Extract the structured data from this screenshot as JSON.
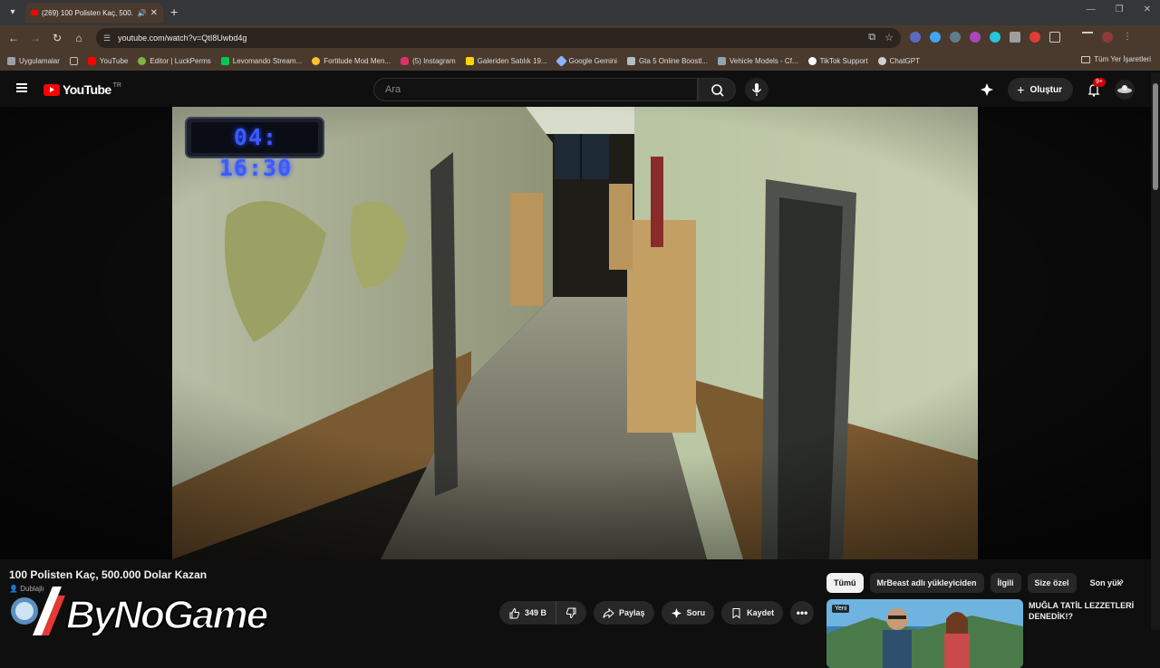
{
  "browser": {
    "tab_title": "(269) 100 Polisten Kaç, 500.",
    "url": "youtube.com/watch?v=QtI8Uwbd4g"
  },
  "bookmarks": {
    "items": [
      {
        "label": "Uygulamalar",
        "color": "#9aa0a6"
      },
      {
        "label": "YouTube",
        "color": "#ff0000"
      },
      {
        "label": "Editor | LuckPerms",
        "color": "#7cb342"
      },
      {
        "label": "Levomando Stream...",
        "color": "#00c853"
      },
      {
        "label": "Fortitude Mod Men...",
        "color": "#fbc02d"
      },
      {
        "label": "(5) Instagram",
        "color": "#e1306c"
      },
      {
        "label": "Galeriden Satılık 19...",
        "color": "#ffd600"
      },
      {
        "label": "Google Gemini",
        "color": "#8ab4f8"
      },
      {
        "label": "Gta 5 Online Boostl...",
        "color": "#b0bec5"
      },
      {
        "label": "Vehicle Models - Cf...",
        "color": "#90a4ae"
      },
      {
        "label": "TikTok Support",
        "color": "#ffffff"
      },
      {
        "label": "ChatGPT",
        "color": "#d0d0d0"
      }
    ],
    "all_label": "Tüm Yer İşaretleri"
  },
  "header": {
    "logo_text": "YouTube",
    "region": "TR",
    "search_placeholder": "Ara",
    "create_label": "Oluştur",
    "notification_count": "9+"
  },
  "player": {
    "timer_text": "04: 16:30"
  },
  "video": {
    "title": "100 Polisten Kaç, 500.000 Dolar Kazan",
    "dub_label": "Dublajlı",
    "like_count": "349 B",
    "share_label": "Paylaş",
    "ask_label": "Soru",
    "save_label": "Kaydet"
  },
  "chips": [
    "Tümü",
    "MrBeast adlı yükleyiciden",
    "İlgili",
    "Size özel",
    "Son yük"
  ],
  "recommendation": {
    "badge": "Yeni",
    "title": "MUĞLA TATİL LEZZETLERİ DENEDİK!?"
  },
  "watermark": {
    "text": "ByNoGame"
  }
}
